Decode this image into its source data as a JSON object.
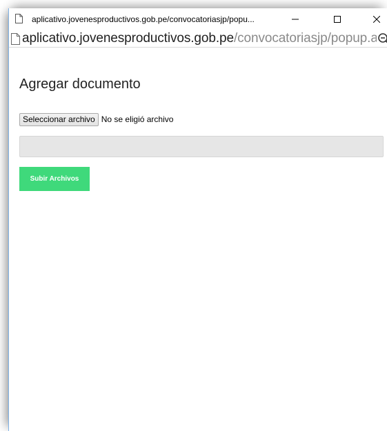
{
  "window": {
    "title": "aplicativo.jovenesproductivos.gob.pe/convocatoriasjp/popu...",
    "controls": {
      "minimize_icon": "minimize-icon",
      "maximize_icon": "maximize-icon",
      "close_icon": "close-icon"
    }
  },
  "address_bar": {
    "host": "aplicativo.jovenesproductivos.gob.pe",
    "path": "/convocatoriasjp/popup.as",
    "page_icon": "document-icon",
    "zoom_icon": "zoom-icon"
  },
  "page": {
    "heading": "Agregar documento",
    "file_input": {
      "button_label": "Seleccionar archivo",
      "status_text": "No se eligió archivo"
    },
    "progress_value": 0,
    "upload_button_label": "Subir Archivos"
  },
  "colors": {
    "upload_button": "#3fd97b",
    "progress_box": "#e6e6e6",
    "window_border": "#7fb2e6"
  }
}
